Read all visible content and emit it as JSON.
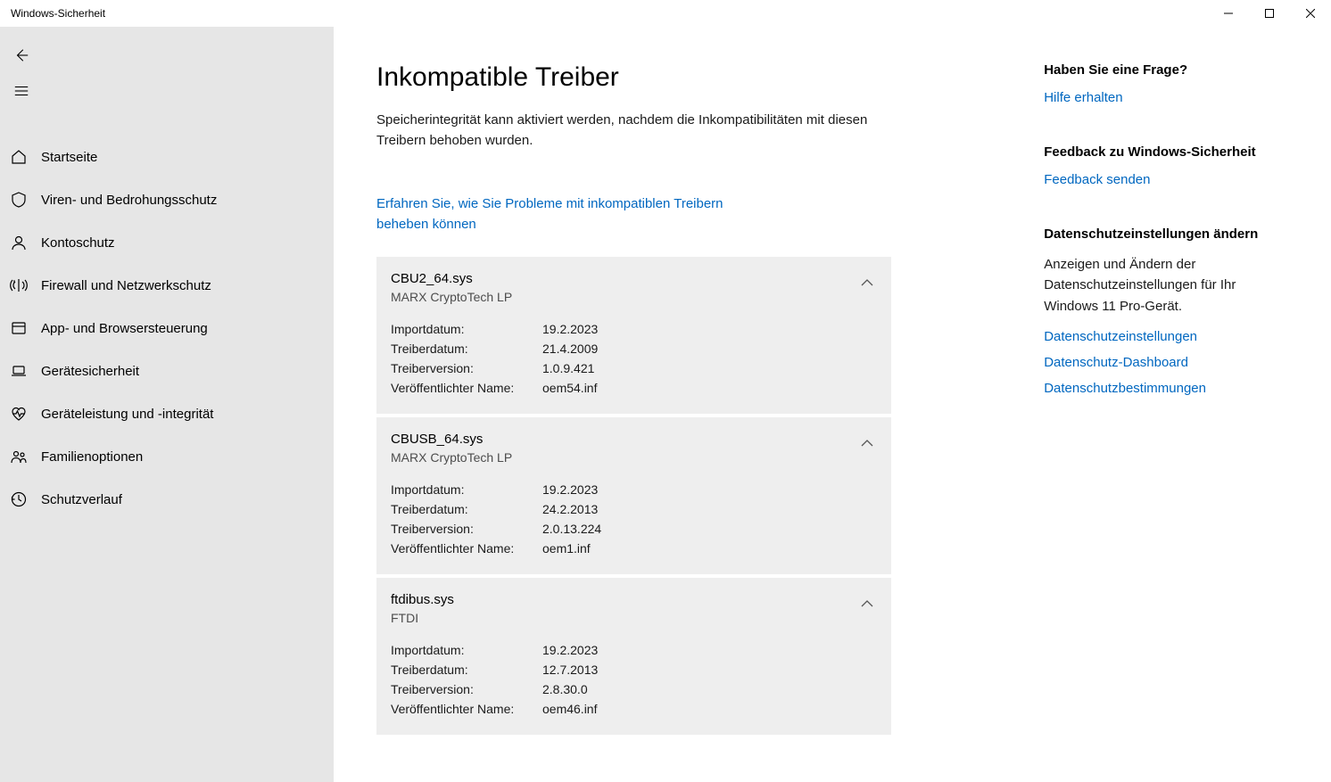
{
  "window": {
    "title": "Windows-Sicherheit"
  },
  "sidebar": {
    "items": [
      {
        "label": "Startseite"
      },
      {
        "label": "Viren- und Bedrohungsschutz"
      },
      {
        "label": "Kontoschutz"
      },
      {
        "label": "Firewall und Netzwerkschutz"
      },
      {
        "label": "App- und Browsersteuerung"
      },
      {
        "label": "Gerätesicherheit"
      },
      {
        "label": "Geräteleistung und -integrität"
      },
      {
        "label": "Familienoptionen"
      },
      {
        "label": "Schutzverlauf"
      }
    ]
  },
  "main": {
    "title": "Inkompatible Treiber",
    "subtitle": "Speicherintegrität kann aktiviert werden, nachdem die Inkompatibilitäten mit diesen Treibern behoben wurden.",
    "learn_link": "Erfahren Sie, wie Sie Probleme mit inkompatiblen Treibern beheben können",
    "labels": {
      "import_date": "Importdatum:",
      "driver_date": "Treiberdatum:",
      "driver_version": "Treiberversion:",
      "published_name": "Veröffentlichter Name:"
    },
    "drivers": [
      {
        "name": "CBU2_64.sys",
        "vendor": "MARX CryptoTech LP",
        "import_date": "19.2.2023",
        "driver_date": "21.4.2009",
        "driver_version": "1.0.9.421",
        "published_name": "oem54.inf"
      },
      {
        "name": "CBUSB_64.sys",
        "vendor": "MARX CryptoTech LP",
        "import_date": "19.2.2023",
        "driver_date": "24.2.2013",
        "driver_version": "2.0.13.224",
        "published_name": "oem1.inf"
      },
      {
        "name": "ftdibus.sys",
        "vendor": "FTDI",
        "import_date": "19.2.2023",
        "driver_date": "12.7.2013",
        "driver_version": "2.8.30.0",
        "published_name": "oem46.inf"
      }
    ]
  },
  "aside": {
    "question": {
      "title": "Haben Sie eine Frage?",
      "link": "Hilfe erhalten"
    },
    "feedback": {
      "title": "Feedback zu Windows-Sicherheit",
      "link": "Feedback senden"
    },
    "privacy": {
      "title": "Datenschutzeinstellungen ändern",
      "text": "Anzeigen und Ändern der Datenschutzeinstellungen für Ihr Windows 11 Pro-Gerät.",
      "links": [
        "Datenschutzeinstellungen",
        "Datenschutz-Dashboard",
        "Datenschutzbestimmungen"
      ]
    }
  }
}
